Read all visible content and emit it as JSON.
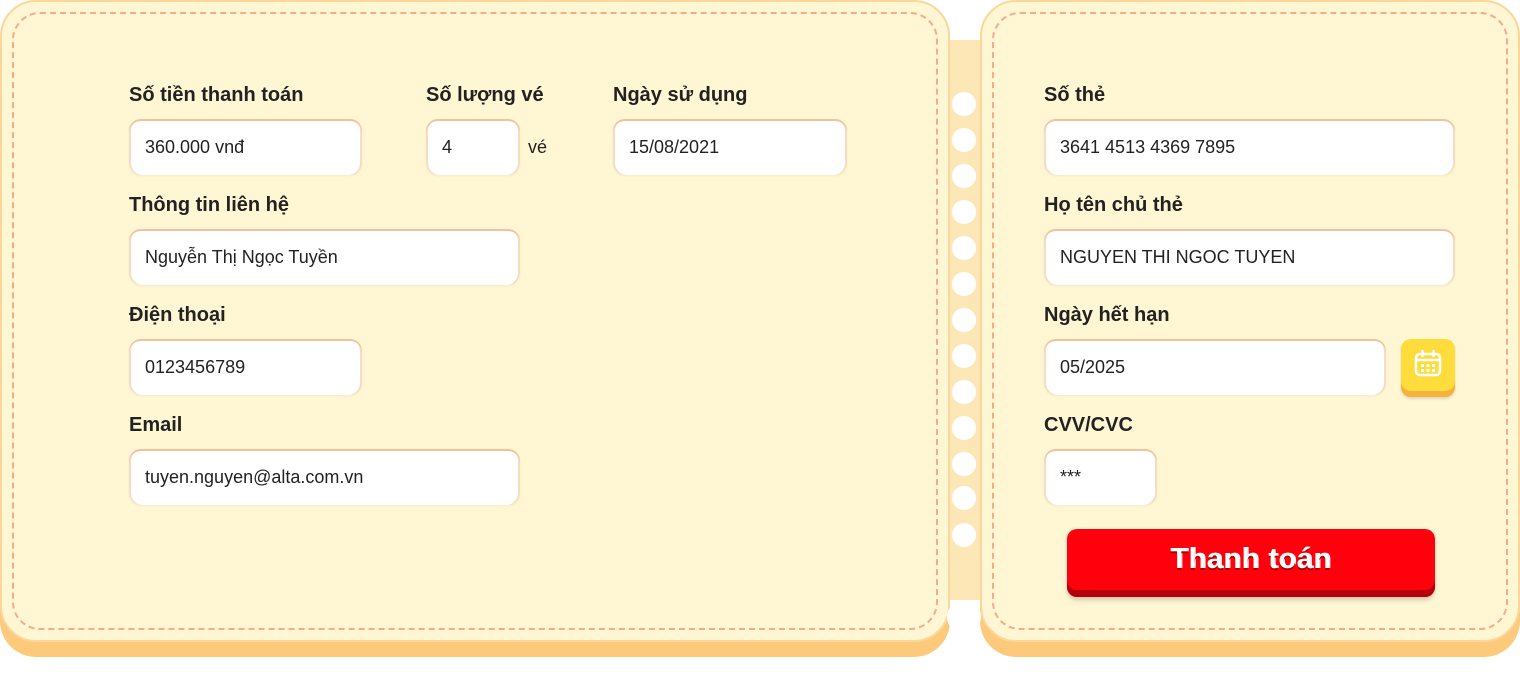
{
  "booking": {
    "amount_label": "Số tiền thanh toán",
    "amount_value": "360.000 vnđ",
    "quantity_label": "Số lượng vé",
    "quantity_value": "4",
    "quantity_unit": "vé",
    "date_label": "Ngày sử dụng",
    "date_value": "15/08/2021",
    "contact_label": "Thông tin liên hệ",
    "contact_value": "Nguyễn Thị Ngọc Tuyền",
    "phone_label": "Điện thoại",
    "phone_value": "0123456789",
    "email_label": "Email",
    "email_value": "tuyen.nguyen@alta.com.vn"
  },
  "payment": {
    "card_number_label": "Số thẻ",
    "card_number_value": "3641 4513 4369 7895",
    "holder_label": "Họ tên chủ thẻ",
    "holder_value": "NGUYEN THI NGOC TUYEN",
    "expiry_label": "Ngày hết hạn",
    "expiry_value": "05/2025",
    "calendar_icon": "calendar-icon",
    "cvv_label": "CVV/CVC",
    "cvv_value": "***",
    "submit_label": "Thanh toán"
  },
  "colors": {
    "ticket_background": "#fff6d3",
    "ticket_shadow": "#fdca7c",
    "dashed_border": "#f7ac88",
    "submit_button": "#ff000c",
    "calendar_button": "#fddc3c"
  }
}
